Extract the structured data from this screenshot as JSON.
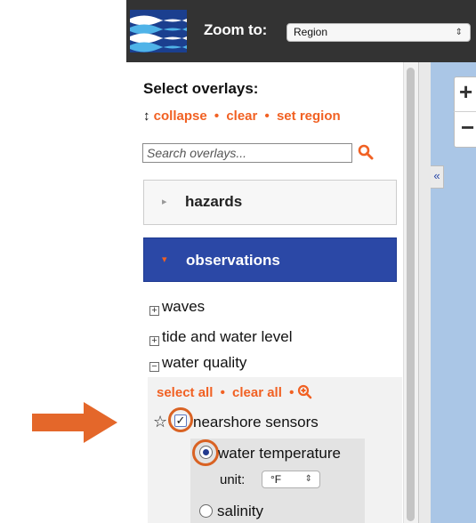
{
  "header": {
    "zoom_label": "Zoom to:",
    "zoom_value": "Region",
    "select_arrows": "⇕"
  },
  "sidebar": {
    "title": "Select overlays:",
    "links_prefix": "↕",
    "collapse": "collapse",
    "clear": "clear",
    "set_region": "set region",
    "separator": "•",
    "search_placeholder": "Search overlays...",
    "categories": [
      {
        "label": "hazards",
        "expanded": false,
        "arrow": "▸"
      },
      {
        "label": "observations",
        "expanded": true,
        "arrow": "▾"
      }
    ],
    "tree": [
      {
        "label": "waves",
        "toggle": "+"
      },
      {
        "label": "tide and water level",
        "toggle": "+"
      },
      {
        "label": "water quality",
        "toggle": "−"
      }
    ],
    "water_quality": {
      "select_all": "select all",
      "clear_all": "clear all",
      "separator": "•",
      "sensors_label": "nearshore sensors",
      "sensors_checked": true,
      "star": "☆",
      "check": "✓",
      "options": [
        {
          "label": "water temperature",
          "selected": true
        },
        {
          "label": "salinity",
          "selected": false
        }
      ],
      "unit_label": "unit:",
      "unit_value": "°F",
      "unit_arrows": "⇕"
    }
  },
  "map": {
    "zoom_in": "+",
    "zoom_out": "−",
    "collapse_tab": "«"
  },
  "colors": {
    "header_bg": "#333333",
    "accent_orange": "#f16123",
    "observations_blue": "#2b48a6",
    "map_water": "#aac6e6",
    "annotation_arrow": "#e4672a"
  },
  "icons": [
    "logo-waves-icon",
    "search-icon",
    "zoom-to-icon",
    "star-icon",
    "checkbox-icon",
    "radio-icon",
    "annotation-arrow-icon"
  ]
}
